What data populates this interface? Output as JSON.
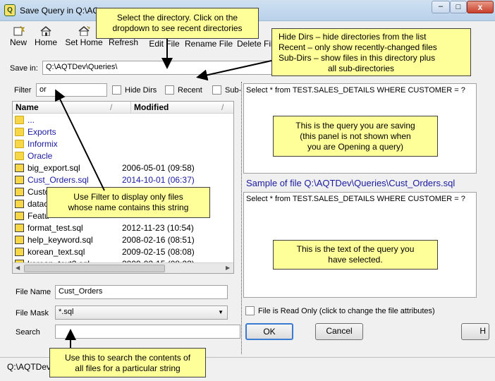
{
  "window": {
    "title": "Save Query in Q:\\AQ",
    "minimize": "‒",
    "maximize": "□",
    "close": "x"
  },
  "toolbar": {
    "new": "New",
    "home": "Home",
    "set_home": "Set Home",
    "refresh": "Refresh",
    "edit_file": "Edit File",
    "rename_file": "Rename File",
    "delete_file": "Delete Fil"
  },
  "save_in": {
    "label": "Save in:",
    "value": "Q:\\AQTDev\\Queries\\"
  },
  "filter": {
    "label": "Filter",
    "value": "or",
    "hide_dirs": "Hide Dirs",
    "recent": "Recent",
    "sub_dirs": "Sub-"
  },
  "file_list": {
    "col_name": "Name",
    "col_modified": "Modified",
    "folders": [
      "...",
      "Exports",
      "Informix",
      "Oracle"
    ],
    "files": [
      {
        "name": "big_export.sql",
        "modified": "2006-05-01 (09:58)",
        "highlight": false
      },
      {
        "name": "Cust_Orders.sql",
        "modified": "2014-10-01 (06:37)",
        "highlight": true
      },
      {
        "name": "Custo",
        "modified": "",
        "highlight": false
      },
      {
        "name": "datac",
        "modified": "",
        "highlight": false
      },
      {
        "name": "Featu",
        "modified": "",
        "highlight": false
      },
      {
        "name": "format_test.sql",
        "modified": "2012-11-23 (10:54)",
        "highlight": false
      },
      {
        "name": "help_keyword.sql",
        "modified": "2008-02-16 (08:51)",
        "highlight": false
      },
      {
        "name": "korean_text.sql",
        "modified": "2009-02-15 (08:08)",
        "highlight": false
      },
      {
        "name": "korean_text2.sql",
        "modified": "2009-02-15 (08:23)",
        "highlight": false
      }
    ]
  },
  "file_name": {
    "label": "File Name",
    "value": "Cust_Orders"
  },
  "file_mask": {
    "label": "File Mask",
    "value": "*.sql"
  },
  "search": {
    "label": "Search",
    "value": ""
  },
  "query_panel": {
    "text": "Select * from TEST.SALES_DETAILS WHERE CUSTOMER = ?"
  },
  "sample": {
    "label": "Sample of file Q:\\AQTDev\\Queries\\Cust_Orders.sql",
    "text": "Select * from TEST.SALES_DETAILS WHERE CUSTOMER = ?"
  },
  "read_only": {
    "label": "File is Read Only (click to change the file attributes)"
  },
  "buttons": {
    "ok": "OK",
    "cancel": "Cancel",
    "help": "H"
  },
  "status": {
    "text": "Q:\\AQTDev"
  },
  "callouts": {
    "directory": {
      "line1": "Select the directory. Click on the",
      "line2": "dropdown  to see recent directories"
    },
    "dirs": {
      "line1": "Hide Dirs – hide directories from the list",
      "line2": "Recent    – only show recently-changed  files",
      "line3": "Sub-Dirs  – show files in this directory plus",
      "line4": "all sub-directories"
    },
    "saving": {
      "line1": "This is the query you are saving",
      "line2": "(this panel is not shown when",
      "line3": "you are Opening a query)"
    },
    "filter": {
      "line1": "Use Filter to display only files",
      "line2": "whose name contains this string"
    },
    "selected": {
      "line1": "This is the text of the query you",
      "line2": "have  selected."
    },
    "search": {
      "line1": "Use this to search the contents of",
      "line2": "all files for a particular string"
    }
  },
  "colors": {
    "link_blue": "#1a1aa0",
    "callout_yellow": "#ffff99",
    "title_bar": "#b9d1ea"
  }
}
